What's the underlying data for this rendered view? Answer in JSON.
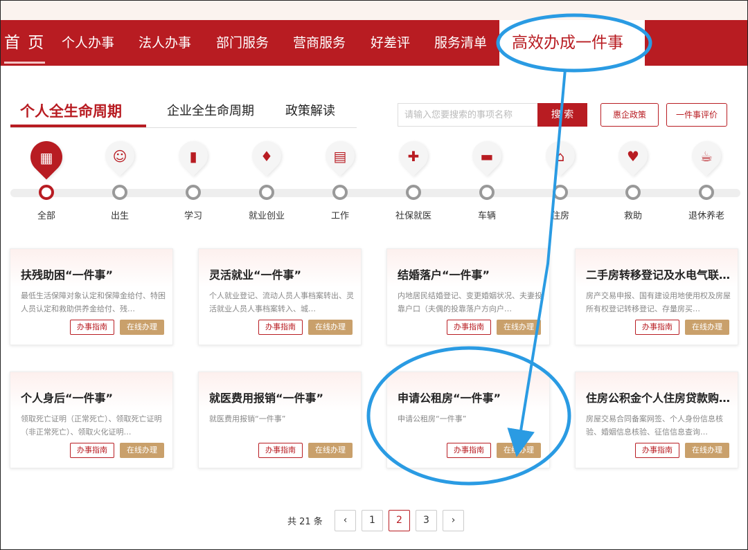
{
  "nav": {
    "items": [
      {
        "label": "首 页"
      },
      {
        "label": "个人办事"
      },
      {
        "label": "法人办事"
      },
      {
        "label": "部门服务"
      },
      {
        "label": "营商服务"
      },
      {
        "label": "好差评"
      },
      {
        "label": "服务清单"
      },
      {
        "label": "高效办成一件事"
      }
    ],
    "active": "高效办成一件事"
  },
  "tabs": [
    {
      "label": "个人全生命周期",
      "active": true
    },
    {
      "label": "企业全生命周期",
      "active": false
    },
    {
      "label": "政策解读",
      "active": false
    }
  ],
  "search": {
    "placeholder": "请输入您要搜索的事项名称",
    "button": "搜 索"
  },
  "actions": {
    "policy": "惠企政策",
    "review": "一件事评价"
  },
  "stages": [
    {
      "label": "全部",
      "icon": "grid-icon",
      "glyph": "▦",
      "active": true
    },
    {
      "label": "出生",
      "icon": "baby-icon",
      "glyph": "☺",
      "active": false
    },
    {
      "label": "学习",
      "icon": "book-icon",
      "glyph": "▮",
      "active": false
    },
    {
      "label": "就业创业",
      "icon": "briefcase-tie-icon",
      "glyph": "♦",
      "active": false
    },
    {
      "label": "工作",
      "icon": "briefcase-icon",
      "glyph": "▤",
      "active": false
    },
    {
      "label": "社保就医",
      "icon": "medical-cross-icon",
      "glyph": "✚",
      "active": false
    },
    {
      "label": "车辆",
      "icon": "car-icon",
      "glyph": "▬",
      "active": false
    },
    {
      "label": "住房",
      "icon": "house-icon",
      "glyph": "⌂",
      "active": false
    },
    {
      "label": "救助",
      "icon": "heart-hand-icon",
      "glyph": "♥",
      "active": false
    },
    {
      "label": "退休养老",
      "icon": "cup-icon",
      "glyph": "☕",
      "active": false
    }
  ],
  "cards": [
    {
      "title": "扶残助困“一件事”",
      "desc": "最低生活保障对象认定和保障金给付、特困人员认定和救助供养金给付、残…"
    },
    {
      "title": "灵活就业“一件事”",
      "desc": "个人就业登记、流动人员人事档案转出、灵活就业人员人事档案转入、城…"
    },
    {
      "title": "结婚落户“一件事”",
      "desc": "内地居民结婚登记、变更婚姻状况、夫妻投靠户口（夫偶的投靠落户方向户…"
    },
    {
      "title": "二手房转移登记及水电气联…",
      "desc": "房产交易申报、国有建设用地使用权及房屋所有权登记转移登记、存量房买…"
    },
    {
      "title": "个人身后“一件事”",
      "desc": "领取死亡证明（正常死亡）、领取死亡证明（非正常死亡）、领取火化证明…"
    },
    {
      "title": "就医费用报销“一件事”",
      "desc": "就医费用报销“一件事”"
    },
    {
      "title": "申请公租房“一件事”",
      "desc": "申请公租房“一件事”"
    },
    {
      "title": "住房公积金个人住房贷款购…",
      "desc": "房屋交易合同备案网签、个人身份信息核验、婚姻信息核验、征信信息查询…"
    }
  ],
  "card_buttons": {
    "guide": "办事指南",
    "online": "在线办理"
  },
  "pager": {
    "total": "共 21 条",
    "prev": "‹",
    "next": "›",
    "pages": [
      "1",
      "2",
      "3"
    ],
    "current": "2"
  },
  "colors": {
    "brand": "#b81c22",
    "gold": "#c9a06b",
    "annotation": "#2a9be3"
  }
}
